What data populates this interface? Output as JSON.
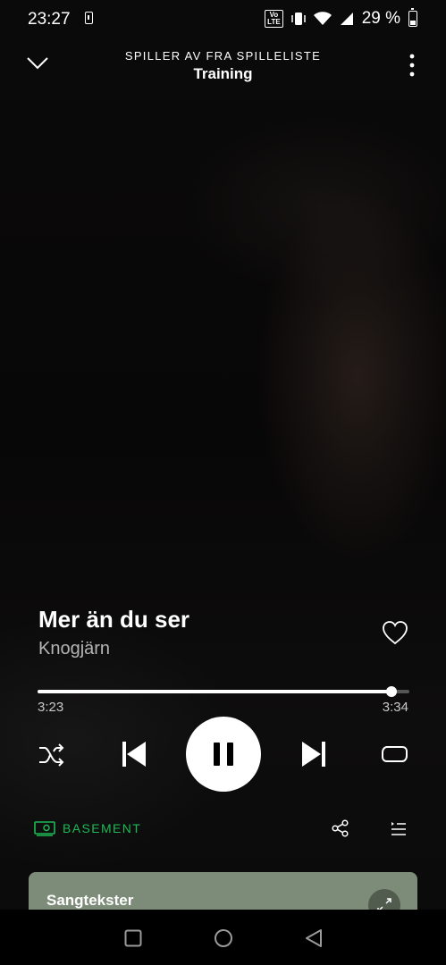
{
  "status_bar": {
    "time": "23:27",
    "volte": "Vo LTE",
    "battery_text": "29 %"
  },
  "header": {
    "subtitle": "SPILLER AV FRA SPILLELISTE",
    "title": "Training"
  },
  "track": {
    "title": "Mer än du ser",
    "artist": "Knogjärn",
    "liked": false
  },
  "playback": {
    "elapsed": "3:23",
    "total": "3:34",
    "progress_fraction": 0.951,
    "state": "playing"
  },
  "device": {
    "name": "BASEMENT",
    "color": "#1db954"
  },
  "lyrics": {
    "title": "Sangtekster",
    "card_color": "#7d8c79"
  },
  "icons": {
    "collapse": "chevron-down-icon",
    "more": "more-vertical-icon",
    "like": "heart-icon",
    "shuffle": "shuffle-icon",
    "previous": "skip-previous-icon",
    "pause": "pause-icon",
    "next": "skip-next-icon",
    "repeat": "repeat-icon",
    "device": "speaker-icon",
    "share": "share-icon",
    "queue": "queue-icon",
    "expand": "expand-icon"
  }
}
